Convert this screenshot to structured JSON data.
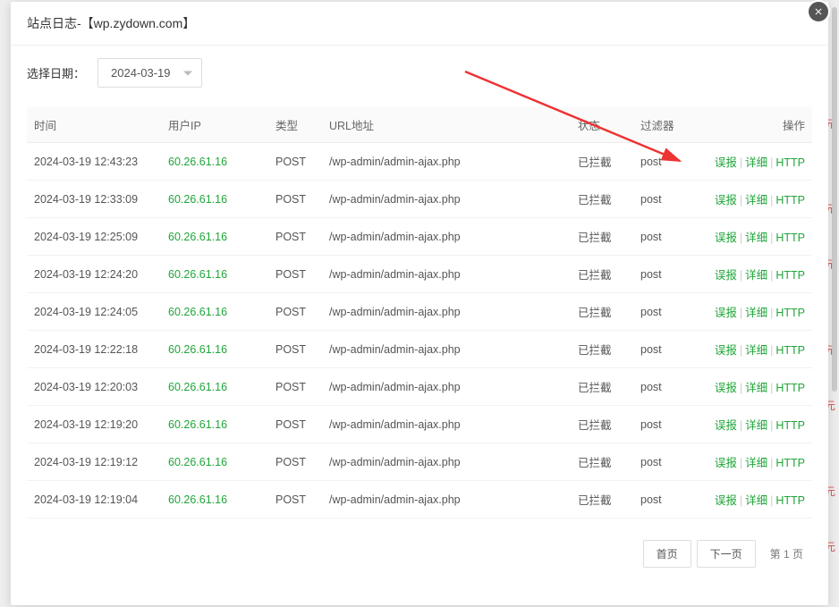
{
  "modal": {
    "title": "站点日志-【wp.zydown.com】"
  },
  "dateFilter": {
    "label": "选择日期：",
    "value": "2024-03-19"
  },
  "table": {
    "headers": {
      "time": "时间",
      "ip": "用户IP",
      "type": "类型",
      "url": "URL地址",
      "status": "状态",
      "filter": "过滤器",
      "action": "操作"
    },
    "rows": [
      {
        "time": "2024-03-19 12:43:23",
        "ip": "60.26.61.16",
        "type": "POST",
        "url": "/wp-admin/admin-ajax.php",
        "status": "已拦截",
        "filter": "post"
      },
      {
        "time": "2024-03-19 12:33:09",
        "ip": "60.26.61.16",
        "type": "POST",
        "url": "/wp-admin/admin-ajax.php",
        "status": "已拦截",
        "filter": "post"
      },
      {
        "time": "2024-03-19 12:25:09",
        "ip": "60.26.61.16",
        "type": "POST",
        "url": "/wp-admin/admin-ajax.php",
        "status": "已拦截",
        "filter": "post"
      },
      {
        "time": "2024-03-19 12:24:20",
        "ip": "60.26.61.16",
        "type": "POST",
        "url": "/wp-admin/admin-ajax.php",
        "status": "已拦截",
        "filter": "post"
      },
      {
        "time": "2024-03-19 12:24:05",
        "ip": "60.26.61.16",
        "type": "POST",
        "url": "/wp-admin/admin-ajax.php",
        "status": "已拦截",
        "filter": "post"
      },
      {
        "time": "2024-03-19 12:22:18",
        "ip": "60.26.61.16",
        "type": "POST",
        "url": "/wp-admin/admin-ajax.php",
        "status": "已拦截",
        "filter": "post"
      },
      {
        "time": "2024-03-19 12:20:03",
        "ip": "60.26.61.16",
        "type": "POST",
        "url": "/wp-admin/admin-ajax.php",
        "status": "已拦截",
        "filter": "post"
      },
      {
        "time": "2024-03-19 12:19:20",
        "ip": "60.26.61.16",
        "type": "POST",
        "url": "/wp-admin/admin-ajax.php",
        "status": "已拦截",
        "filter": "post"
      },
      {
        "time": "2024-03-19 12:19:12",
        "ip": "60.26.61.16",
        "type": "POST",
        "url": "/wp-admin/admin-ajax.php",
        "status": "已拦截",
        "filter": "post"
      },
      {
        "time": "2024-03-19 12:19:04",
        "ip": "60.26.61.16",
        "type": "POST",
        "url": "/wp-admin/admin-ajax.php",
        "status": "已拦截",
        "filter": "post"
      }
    ]
  },
  "actions": {
    "falsePositive": "误报",
    "detail": "详细",
    "http": "HTTP",
    "separator": "|"
  },
  "pagination": {
    "first": "首页",
    "next": "下一页",
    "info": "第 1 页"
  },
  "bg": {
    "yuan": "元"
  }
}
